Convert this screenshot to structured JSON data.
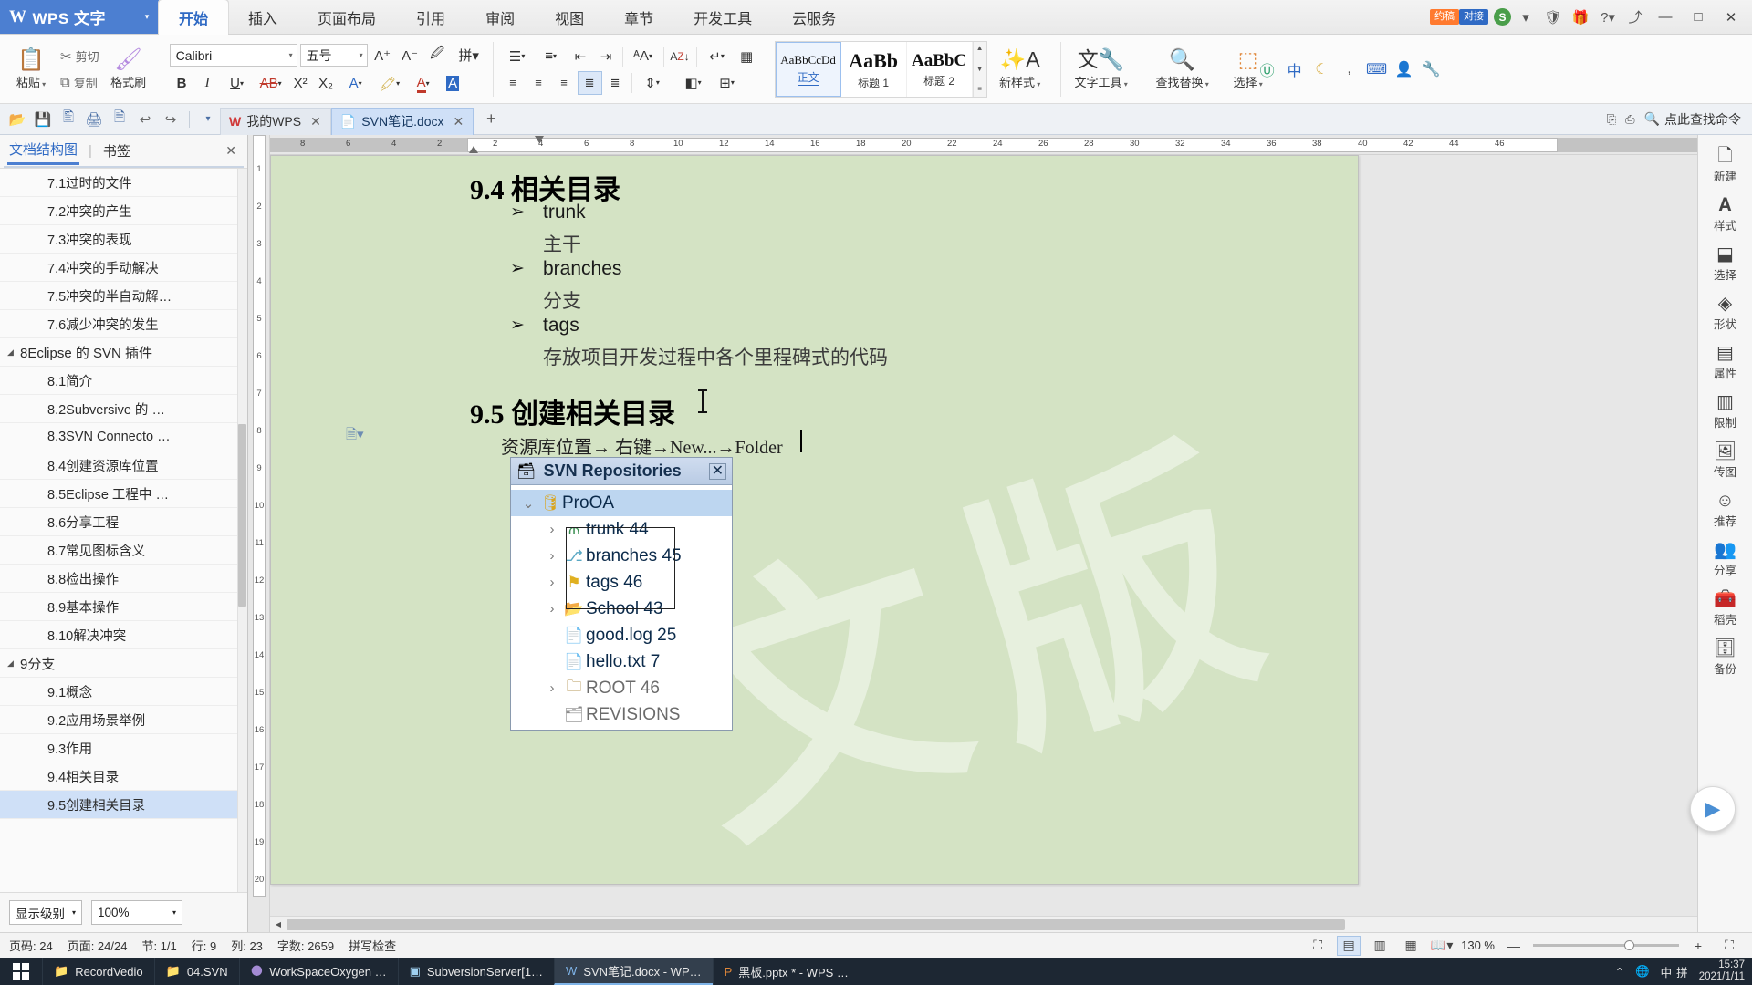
{
  "titlebar": {
    "app_name": "WPS 文字",
    "logo": "W",
    "dropdown_caret": "▾",
    "tabs": [
      {
        "label": "开始",
        "active": true
      },
      {
        "label": "插入",
        "active": false
      },
      {
        "label": "页面布局",
        "active": false
      },
      {
        "label": "引用",
        "active": false
      },
      {
        "label": "审阅",
        "active": false
      },
      {
        "label": "视图",
        "active": false
      },
      {
        "label": "章节",
        "active": false
      },
      {
        "label": "开发工具",
        "active": false
      },
      {
        "label": "云服务",
        "active": false
      }
    ],
    "badge_left": "约稿",
    "badge_right": "对接",
    "account_initial": "S",
    "icons": [
      "chevron-down-icon",
      "shield-icon",
      "gift-icon",
      "help-icon",
      "share-icon"
    ],
    "window_buttons": {
      "minimize": "—",
      "maximize": "□",
      "close": "✕"
    }
  },
  "ribbon": {
    "clipboard": {
      "paste_label": "粘贴",
      "cut_label": "剪切",
      "copy_label": "复制",
      "format_painter_label": "格式刷"
    },
    "font": {
      "name_value": "Calibri",
      "size_value": "五号",
      "grow_label": "A⁺",
      "shrink_label": "A⁻",
      "bold": "B",
      "italic": "I",
      "underline": "U",
      "strike": "AB",
      "superscript": "X²",
      "subscript": "X₂",
      "text_effect": "A",
      "highlight": "✎",
      "font_color": "A",
      "char_shade": "A"
    },
    "paragraph": {
      "bullets": "☰",
      "numbering": "≡",
      "dec_indent": "⇤",
      "inc_indent": "⇥",
      "pinyin": "ᴬA",
      "sort": "A↓Z",
      "show_marks": "¶",
      "borders": "⊞",
      "align_left": "≡",
      "align_center": "≡",
      "align_right": "≡",
      "justify": "≡",
      "distribute": "≡",
      "line_spacing": "↕",
      "shading": "◧",
      "border_menu": "⊡"
    },
    "styles": {
      "items": [
        {
          "preview": "AaBbCcDd",
          "name": "正文",
          "selected": true
        },
        {
          "preview": "AaBb",
          "name": "标题 1",
          "selected": false
        },
        {
          "preview": "AaBbC",
          "name": "标题 2",
          "selected": false
        }
      ],
      "new_style_label": "新样式",
      "scroll_up": "▲",
      "scroll_down": "▼",
      "scroll_more": "≡"
    },
    "text_tools_label": "文字工具",
    "find_replace_label": "查找替换",
    "select_label": "选择",
    "extra_icons": [
      "u-circle-icon",
      "chinese-icon",
      "moon-icon",
      "comma-icon",
      "keyboard-icon",
      "user-icon",
      "wrench-icon"
    ]
  },
  "tabbar": {
    "quick_actions": [
      "open-icon",
      "save-icon",
      "print-preview-icon",
      "print-icon",
      "export-pdf-icon",
      "undo-icon",
      "redo-icon",
      "customize-icon"
    ],
    "tabs": [
      {
        "label": "我的WPS",
        "icon": "wps-logo-icon",
        "active": false,
        "closable": true
      },
      {
        "label": "SVN笔记.docx",
        "icon": "doc-icon",
        "active": true,
        "closable": true
      }
    ],
    "new_tab": "+",
    "right_icons": [
      "backstage-icon",
      "restore-icon"
    ],
    "find_command": "点此查找命令"
  },
  "navpane": {
    "tab_structure": "文档结构图",
    "tab_bookmark": "书签",
    "close": "✕",
    "items": [
      {
        "label": "7.1过时的文件",
        "level": 2,
        "selected": false,
        "expander": ""
      },
      {
        "label": "7.2冲突的产生",
        "level": 2,
        "selected": false,
        "expander": ""
      },
      {
        "label": "7.3冲突的表现",
        "level": 2,
        "selected": false,
        "expander": ""
      },
      {
        "label": "7.4冲突的手动解决",
        "level": 2,
        "selected": false,
        "expander": ""
      },
      {
        "label": "7.5冲突的半自动解…",
        "level": 2,
        "selected": false,
        "expander": ""
      },
      {
        "label": "7.6减少冲突的发生",
        "level": 2,
        "selected": false,
        "expander": ""
      },
      {
        "label": "8Eclipse 的 SVN 插件",
        "level": 1,
        "selected": false,
        "expander": "◢"
      },
      {
        "label": "8.1简介",
        "level": 2,
        "selected": false,
        "expander": ""
      },
      {
        "label": "8.2Subversive 的 …",
        "level": 2,
        "selected": false,
        "expander": ""
      },
      {
        "label": "8.3SVN Connecto …",
        "level": 2,
        "selected": false,
        "expander": ""
      },
      {
        "label": "8.4创建资源库位置",
        "level": 2,
        "selected": false,
        "expander": ""
      },
      {
        "label": "8.5Eclipse 工程中 …",
        "level": 2,
        "selected": false,
        "expander": ""
      },
      {
        "label": "8.6分享工程",
        "level": 2,
        "selected": false,
        "expander": ""
      },
      {
        "label": "8.7常见图标含义",
        "level": 2,
        "selected": false,
        "expander": ""
      },
      {
        "label": "8.8检出操作",
        "level": 2,
        "selected": false,
        "expander": ""
      },
      {
        "label": "8.9基本操作",
        "level": 2,
        "selected": false,
        "expander": ""
      },
      {
        "label": "8.10解决冲突",
        "level": 2,
        "selected": false,
        "expander": ""
      },
      {
        "label": "9分支",
        "level": 1,
        "selected": false,
        "expander": "◢"
      },
      {
        "label": "9.1概念",
        "level": 2,
        "selected": false,
        "expander": ""
      },
      {
        "label": "9.2应用场景举例",
        "level": 2,
        "selected": false,
        "expander": ""
      },
      {
        "label": "9.3作用",
        "level": 2,
        "selected": false,
        "expander": ""
      },
      {
        "label": "9.4相关目录",
        "level": 2,
        "selected": false,
        "expander": ""
      },
      {
        "label": "9.5创建相关目录",
        "level": 2,
        "selected": true,
        "expander": ""
      }
    ],
    "footer": {
      "level_label": "显示级别",
      "level_caret": "▾",
      "zoom_value": "100%",
      "zoom_caret": "▾"
    }
  },
  "ruler": {
    "h_ticks": [
      "8",
      "6",
      "4",
      "2",
      "2",
      "4",
      "6",
      "8",
      "10",
      "12",
      "14",
      "16",
      "18",
      "20",
      "22",
      "24",
      "26",
      "28",
      "30",
      "32",
      "34",
      "36",
      "38",
      "40",
      "42",
      "44",
      "46"
    ],
    "v_ticks": [
      "1",
      "2",
      "3",
      "4",
      "5",
      "6",
      "7",
      "8",
      "9",
      "10",
      "11",
      "12",
      "13",
      "14",
      "15",
      "16",
      "17",
      "18",
      "19",
      "20"
    ]
  },
  "document": {
    "heading_94": "9.4  相关目录",
    "bullets_94": [
      {
        "term": "trunk",
        "desc": "主干"
      },
      {
        "term": "branches",
        "desc": "分支"
      },
      {
        "term": "tags",
        "desc": "存放项目开发过程中各个里程碑式的代码"
      }
    ],
    "bullet_mark": "➢",
    "heading_95": "9.5  创建相关目录",
    "body_95": "资源库位置→ 右键→New...→Folder",
    "watermark": "文 版",
    "svn_window": {
      "title": "SVN Repositories",
      "title_icon": "repository-icon",
      "close_icon": "✕",
      "rows": [
        {
          "label": "ProOA",
          "icon": "repo-cylinder-icon",
          "arrow": "⌄",
          "selected": true,
          "indent": 0,
          "gray": false
        },
        {
          "label": "trunk 44",
          "icon": "trunk-icon",
          "arrow": "›",
          "selected": false,
          "indent": 1,
          "gray": false
        },
        {
          "label": "branches 45",
          "icon": "branches-icon",
          "arrow": "›",
          "selected": false,
          "indent": 1,
          "gray": false
        },
        {
          "label": "tags 46",
          "icon": "tags-flag-icon",
          "arrow": "›",
          "selected": false,
          "indent": 1,
          "gray": false
        },
        {
          "label": "School 43",
          "icon": "folder-icon",
          "arrow": "›",
          "selected": false,
          "indent": 1,
          "gray": false
        },
        {
          "label": "good.log 25",
          "icon": "file-icon",
          "arrow": "",
          "selected": false,
          "indent": 1,
          "gray": false
        },
        {
          "label": "hello.txt 7",
          "icon": "file-icon",
          "arrow": "",
          "selected": false,
          "indent": 1,
          "gray": false
        },
        {
          "label": "ROOT 46",
          "icon": "folder-lock-icon",
          "arrow": "›",
          "selected": false,
          "indent": 1,
          "gray": true
        },
        {
          "label": "REVISIONS",
          "icon": "revisions-icon",
          "arrow": "",
          "selected": false,
          "indent": 1,
          "gray": true
        }
      ]
    }
  },
  "rightbar": {
    "items": [
      {
        "label": "新建",
        "icon": "new-doc-icon"
      },
      {
        "label": "样式",
        "icon": "styles-icon"
      },
      {
        "label": "选择",
        "icon": "select-icon"
      },
      {
        "label": "形状",
        "icon": "shapes-icon"
      },
      {
        "label": "属性",
        "icon": "properties-icon"
      },
      {
        "label": "限制",
        "icon": "restrict-icon"
      },
      {
        "label": "传图",
        "icon": "upload-image-icon"
      },
      {
        "label": "推荐",
        "icon": "recommend-icon"
      },
      {
        "label": "分享",
        "icon": "share-icon"
      },
      {
        "label": "稻壳",
        "icon": "docer-icon"
      },
      {
        "label": "备份",
        "icon": "backup-icon"
      }
    ],
    "play_button": "▶"
  },
  "statusbar": {
    "page_label": "页码: 24",
    "page_count": "页面: 24/24",
    "section": "节: 1/1",
    "row": "行: 9",
    "col": "列: 23",
    "words": "字数: 2659",
    "spellcheck": "拼写检查",
    "view_icons": [
      "full-screen-icon",
      "page-view-icon",
      "outline-view-icon",
      "web-view-icon",
      "reading-view-icon"
    ],
    "zoom_percent": "130 %",
    "zoom_minus": "—",
    "zoom_plus": "+",
    "fullscreen_icon": "⛶"
  },
  "taskbar": {
    "start_icon": "windows-start-icon",
    "apps": [
      {
        "label": "RecordVedio",
        "icon": "folder-icon",
        "active": false
      },
      {
        "label": "04.SVN",
        "icon": "folder-icon",
        "active": false
      },
      {
        "label": "WorkSpaceOxygen …",
        "icon": "eclipse-icon",
        "active": false
      },
      {
        "label": "SubversionServer[1…",
        "icon": "terminal-icon",
        "active": false
      },
      {
        "label": "SVN笔记.docx - WP…",
        "icon": "wps-icon",
        "active": true
      },
      {
        "label": "黑板.pptx * - WPS …",
        "icon": "wpp-icon",
        "active": false
      }
    ],
    "tray": {
      "chevron": "⌃",
      "network_icon": "network-icon",
      "ime": "中",
      "ime_sub": "拼",
      "time": "15:37",
      "date": "2021/1/11"
    }
  }
}
